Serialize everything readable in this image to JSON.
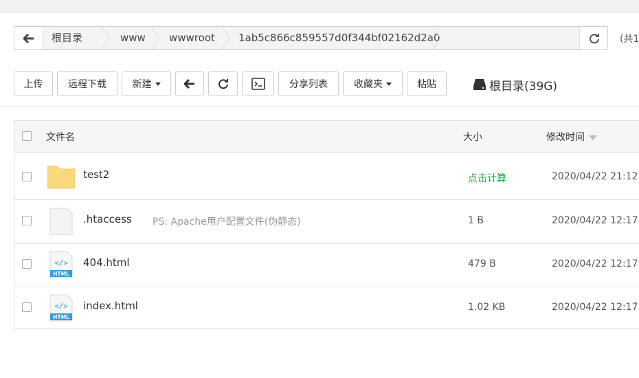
{
  "breadcrumb": {
    "items": [
      "根目录",
      "www",
      "wwwroot",
      "1ab5c866c859557d0f344bf02162d2a0"
    ],
    "total_label": "(共1"
  },
  "toolbar": {
    "upload": "上传",
    "remote_download": "远程下载",
    "new": "新建",
    "share_list": "分享列表",
    "favorites": "收藏夹",
    "paste": "粘贴"
  },
  "disk": {
    "label": "根目录(39G)"
  },
  "table": {
    "headers": {
      "name": "文件名",
      "size": "大小",
      "modified": "修改时间"
    },
    "rows": [
      {
        "name": "test2",
        "type": "folder",
        "note": "",
        "size": "点击计算",
        "time": "2020/04/22 21:12"
      },
      {
        "name": ".htaccess",
        "type": "file",
        "note": "PS: Apache用户配置文件(伪静态)",
        "size": "1 B",
        "time": "2020/04/22 12:17"
      },
      {
        "name": "404.html",
        "type": "html",
        "note": "",
        "size": "479 B",
        "time": "2020/04/22 12:17"
      },
      {
        "name": "index.html",
        "type": "html",
        "note": "",
        "size": "1.02 KB",
        "time": "2020/04/22 12:17"
      }
    ]
  },
  "icons": {
    "html_badge": "HTML",
    "html_code": "</>"
  },
  "colors": {
    "accent_green": "#20a53a",
    "html_blue": "#3a9bd6",
    "folder_yellow": "#f9d97c"
  }
}
